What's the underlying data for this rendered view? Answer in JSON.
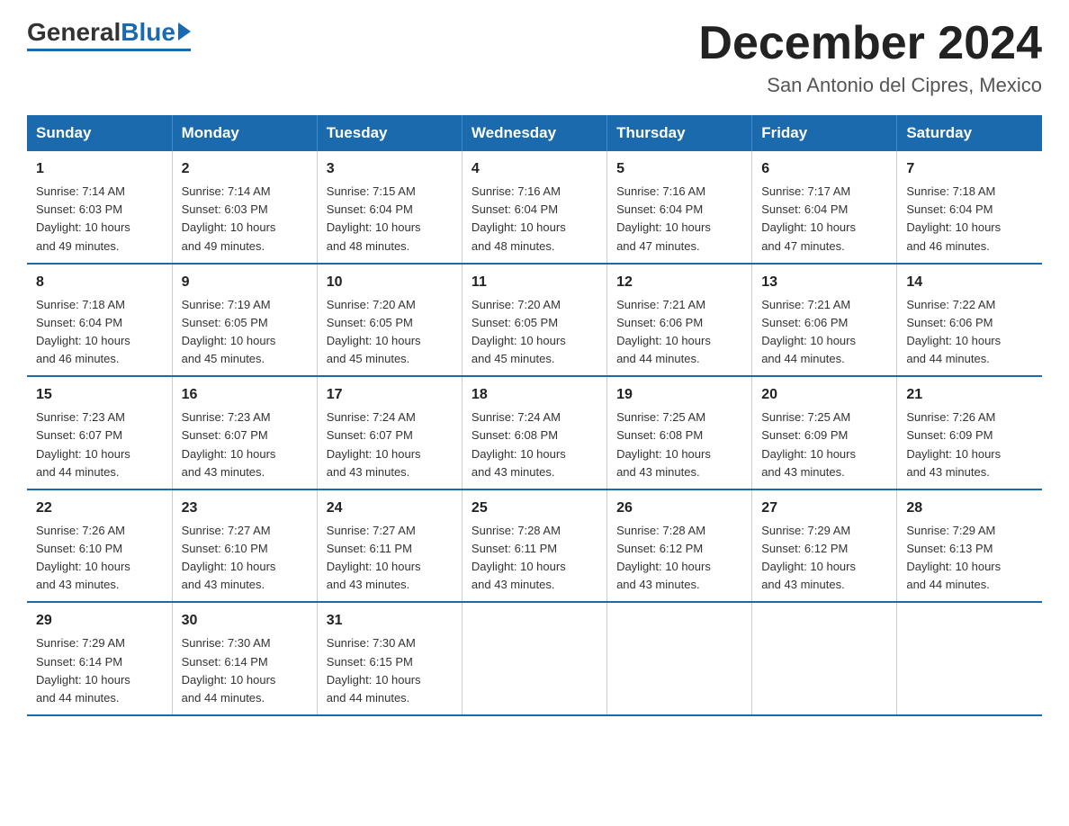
{
  "logo": {
    "general": "General",
    "blue": "Blue"
  },
  "title": {
    "month": "December 2024",
    "location": "San Antonio del Cipres, Mexico"
  },
  "days_header": [
    "Sunday",
    "Monday",
    "Tuesday",
    "Wednesday",
    "Thursday",
    "Friday",
    "Saturday"
  ],
  "weeks": [
    [
      {
        "day": "1",
        "sunrise": "7:14 AM",
        "sunset": "6:03 PM",
        "daylight": "10 hours and 49 minutes."
      },
      {
        "day": "2",
        "sunrise": "7:14 AM",
        "sunset": "6:03 PM",
        "daylight": "10 hours and 49 minutes."
      },
      {
        "day": "3",
        "sunrise": "7:15 AM",
        "sunset": "6:04 PM",
        "daylight": "10 hours and 48 minutes."
      },
      {
        "day": "4",
        "sunrise": "7:16 AM",
        "sunset": "6:04 PM",
        "daylight": "10 hours and 48 minutes."
      },
      {
        "day": "5",
        "sunrise": "7:16 AM",
        "sunset": "6:04 PM",
        "daylight": "10 hours and 47 minutes."
      },
      {
        "day": "6",
        "sunrise": "7:17 AM",
        "sunset": "6:04 PM",
        "daylight": "10 hours and 47 minutes."
      },
      {
        "day": "7",
        "sunrise": "7:18 AM",
        "sunset": "6:04 PM",
        "daylight": "10 hours and 46 minutes."
      }
    ],
    [
      {
        "day": "8",
        "sunrise": "7:18 AM",
        "sunset": "6:04 PM",
        "daylight": "10 hours and 46 minutes."
      },
      {
        "day": "9",
        "sunrise": "7:19 AM",
        "sunset": "6:05 PM",
        "daylight": "10 hours and 45 minutes."
      },
      {
        "day": "10",
        "sunrise": "7:20 AM",
        "sunset": "6:05 PM",
        "daylight": "10 hours and 45 minutes."
      },
      {
        "day": "11",
        "sunrise": "7:20 AM",
        "sunset": "6:05 PM",
        "daylight": "10 hours and 45 minutes."
      },
      {
        "day": "12",
        "sunrise": "7:21 AM",
        "sunset": "6:06 PM",
        "daylight": "10 hours and 44 minutes."
      },
      {
        "day": "13",
        "sunrise": "7:21 AM",
        "sunset": "6:06 PM",
        "daylight": "10 hours and 44 minutes."
      },
      {
        "day": "14",
        "sunrise": "7:22 AM",
        "sunset": "6:06 PM",
        "daylight": "10 hours and 44 minutes."
      }
    ],
    [
      {
        "day": "15",
        "sunrise": "7:23 AM",
        "sunset": "6:07 PM",
        "daylight": "10 hours and 44 minutes."
      },
      {
        "day": "16",
        "sunrise": "7:23 AM",
        "sunset": "6:07 PM",
        "daylight": "10 hours and 43 minutes."
      },
      {
        "day": "17",
        "sunrise": "7:24 AM",
        "sunset": "6:07 PM",
        "daylight": "10 hours and 43 minutes."
      },
      {
        "day": "18",
        "sunrise": "7:24 AM",
        "sunset": "6:08 PM",
        "daylight": "10 hours and 43 minutes."
      },
      {
        "day": "19",
        "sunrise": "7:25 AM",
        "sunset": "6:08 PM",
        "daylight": "10 hours and 43 minutes."
      },
      {
        "day": "20",
        "sunrise": "7:25 AM",
        "sunset": "6:09 PM",
        "daylight": "10 hours and 43 minutes."
      },
      {
        "day": "21",
        "sunrise": "7:26 AM",
        "sunset": "6:09 PM",
        "daylight": "10 hours and 43 minutes."
      }
    ],
    [
      {
        "day": "22",
        "sunrise": "7:26 AM",
        "sunset": "6:10 PM",
        "daylight": "10 hours and 43 minutes."
      },
      {
        "day": "23",
        "sunrise": "7:27 AM",
        "sunset": "6:10 PM",
        "daylight": "10 hours and 43 minutes."
      },
      {
        "day": "24",
        "sunrise": "7:27 AM",
        "sunset": "6:11 PM",
        "daylight": "10 hours and 43 minutes."
      },
      {
        "day": "25",
        "sunrise": "7:28 AM",
        "sunset": "6:11 PM",
        "daylight": "10 hours and 43 minutes."
      },
      {
        "day": "26",
        "sunrise": "7:28 AM",
        "sunset": "6:12 PM",
        "daylight": "10 hours and 43 minutes."
      },
      {
        "day": "27",
        "sunrise": "7:29 AM",
        "sunset": "6:12 PM",
        "daylight": "10 hours and 43 minutes."
      },
      {
        "day": "28",
        "sunrise": "7:29 AM",
        "sunset": "6:13 PM",
        "daylight": "10 hours and 44 minutes."
      }
    ],
    [
      {
        "day": "29",
        "sunrise": "7:29 AM",
        "sunset": "6:14 PM",
        "daylight": "10 hours and 44 minutes."
      },
      {
        "day": "30",
        "sunrise": "7:30 AM",
        "sunset": "6:14 PM",
        "daylight": "10 hours and 44 minutes."
      },
      {
        "day": "31",
        "sunrise": "7:30 AM",
        "sunset": "6:15 PM",
        "daylight": "10 hours and 44 minutes."
      },
      null,
      null,
      null,
      null
    ]
  ],
  "labels": {
    "sunrise": "Sunrise:",
    "sunset": "Sunset:",
    "daylight": "Daylight:"
  }
}
